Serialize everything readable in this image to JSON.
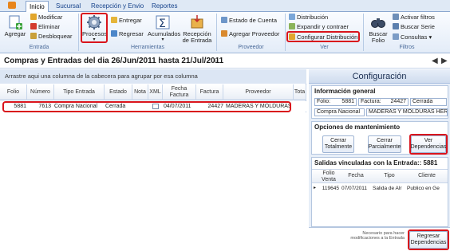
{
  "tabs": [
    "Inicio",
    "Sucursal",
    "Recepción y Envio",
    "Reportes"
  ],
  "ribbon": {
    "entrada": {
      "agregar": "Agregar",
      "modificar": "Modificar",
      "eliminar": "Eliminar",
      "desbloquear": "Desbloquear",
      "label": "Entrada"
    },
    "herramientas": {
      "procesos": "Procesos",
      "entregar": "Entregar",
      "regresar": "Regresar",
      "acumulados": "Acumulados",
      "recepcion_line1": "Recepción",
      "recepcion_line2": "de Entrada",
      "label": "Herramientas"
    },
    "proveedor": {
      "estado_cuenta": "Estado de Cuenta",
      "agregar_proveedor": "Agregar Proveedor",
      "label": "Proveedor"
    },
    "ver": {
      "distribucion": "Distribución",
      "expandir": "Expandir y contraer",
      "configurar": "Configurar Distribución",
      "label": "Ver"
    },
    "filtros": {
      "buscar_line1": "Buscar",
      "buscar_line2": "Folio",
      "activar": "Activar filtros",
      "buscar_serie": "Buscar Serie",
      "consultas": "Consultas",
      "label": "Filtros"
    }
  },
  "page_title": "Compras y Entradas  del dia 26/Jun/2011 hasta 21/Jul/2011",
  "grid": {
    "group_hint": "Arrastre aqui una columna de la cabecera para agrupar por esa columna",
    "headers": [
      "Folio",
      "Número",
      "Tipo Entrada",
      "Estado",
      "Nota",
      "XML",
      "Fecha Factura",
      "Factura",
      "Proveedor",
      "Tota"
    ],
    "row": {
      "folio": "5881",
      "numero": "7613",
      "tipo": "Compra Nacional",
      "estado": "Cerrada",
      "fecha": "04/07/2011",
      "factura": "24427",
      "proveedor": "MADERAS Y MOLDURAS H"
    }
  },
  "config": {
    "title": "Configuración",
    "info_title": "Información general",
    "folio_label": "Folio:",
    "folio_value": "5881",
    "factura_label": "Factura:",
    "factura_value": "24427",
    "estado_value": "Cerrada",
    "tipo_value": "Compra Nacional",
    "proveedor_value": "MADERAS Y MOLDURAS HERNAI",
    "mant_title": "Opciones de mantenimiento",
    "btn_cerrar_total_1": "Cerrar",
    "btn_cerrar_total_2": "Totalmente",
    "btn_cerrar_parcial_1": "Cerrar",
    "btn_cerrar_parcial_2": "Parcialmente",
    "btn_ver_dep_1": "Ver",
    "btn_ver_dep_2": "Dependencias",
    "salidas_title": "Salidas vinculadas con la Entrada:: 5881",
    "salidas_headers": [
      "Folio Venta",
      "Fecha",
      "Tipo",
      "Cliente"
    ],
    "salidas_row": {
      "folio": "119645",
      "fecha": "07/07/2011",
      "tipo": "Salida de Alr",
      "cliente": "Publico en Ge"
    },
    "foot_note": "Necesario para hacer modificaciones a la Entrada",
    "btn_regresar_dep_1": "Regresar",
    "btn_regresar_dep_2": "Dependencias"
  }
}
